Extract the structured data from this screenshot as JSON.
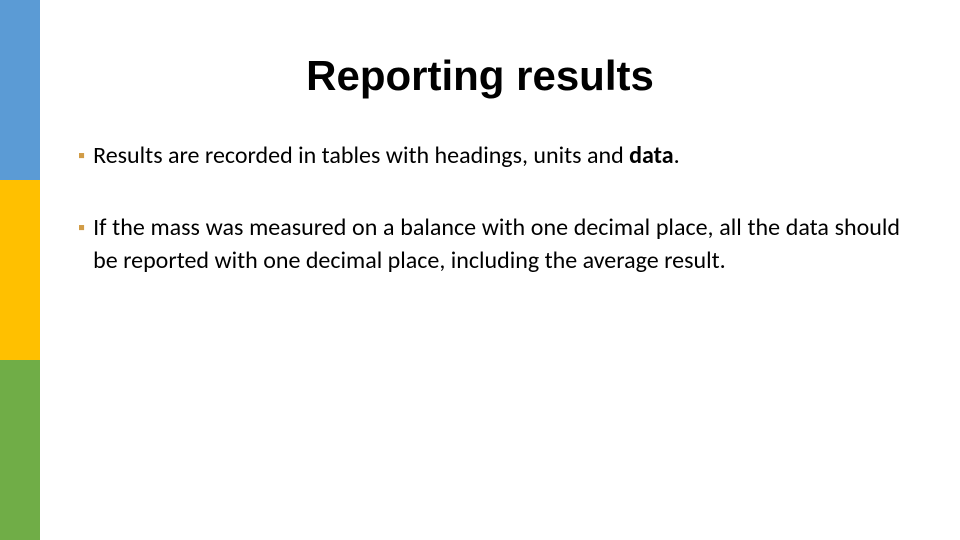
{
  "title": "Reporting results",
  "bullets": [
    {
      "runs": [
        {
          "text": "Results are recorded in tables with headings, units and ",
          "bold": false
        },
        {
          "text": "data",
          "bold": true
        },
        {
          "text": ".",
          "bold": false
        }
      ]
    },
    {
      "runs": [
        {
          "text": "If the mass was measured on a balance with one decimal place, all the data should be reported with one decimal place, including the average result.",
          "bold": false
        }
      ]
    }
  ],
  "sidebar_colors": [
    "#5b9bd5",
    "#ffc000",
    "#70ad47"
  ]
}
